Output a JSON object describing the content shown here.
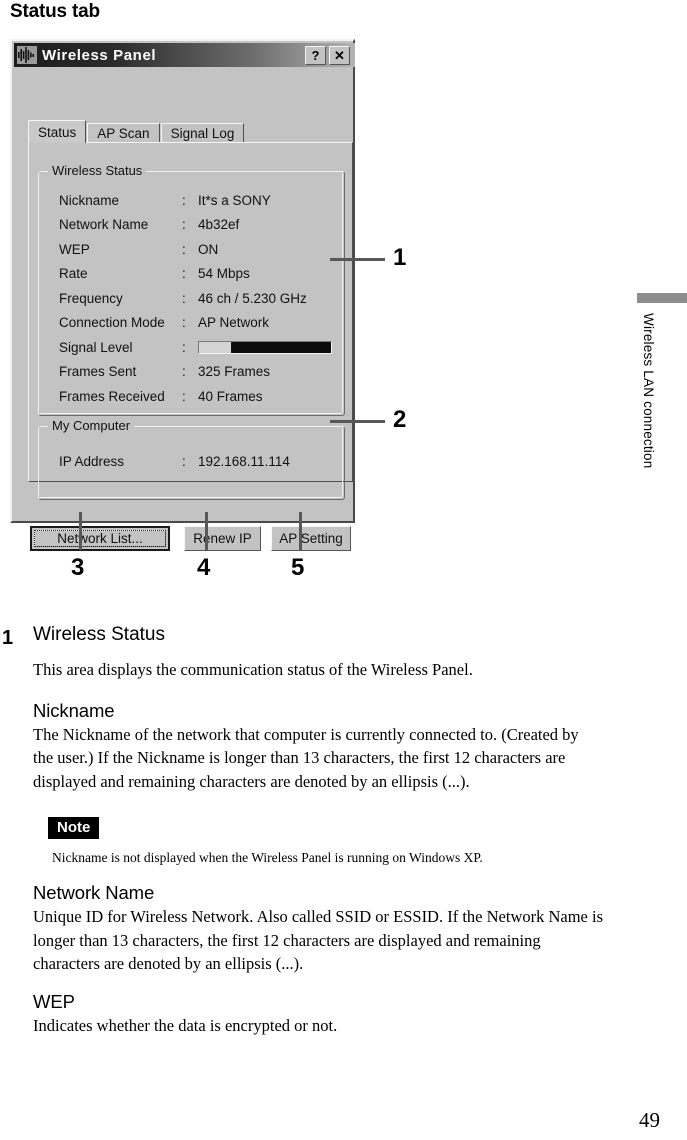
{
  "page": {
    "heading": "Status tab",
    "number": "49",
    "side_tab": "Wireless LAN connection"
  },
  "dialog": {
    "title": "Wireless Panel",
    "title_icon": "signal-wave-icon",
    "help_button": "?",
    "close_button": "✕",
    "tabs": [
      {
        "label": "Status",
        "active": true
      },
      {
        "label": "AP Scan",
        "active": false
      },
      {
        "label": "Signal Log",
        "active": false
      }
    ],
    "wireless_status": {
      "group_title": "Wireless Status",
      "rows": [
        {
          "label": "Nickname",
          "separator": ":",
          "value": "It*s a SONY"
        },
        {
          "label": "Network Name",
          "separator": ":",
          "value": "4b32ef"
        },
        {
          "label": "WEP",
          "separator": ":",
          "value": "ON"
        },
        {
          "label": "Rate",
          "separator": ":",
          "value": "54 Mbps"
        },
        {
          "label": "Frequency",
          "separator": ":",
          "value": "46 ch / 5.230 GHz"
        },
        {
          "label": "Connection Mode",
          "separator": ":",
          "value": "AP Network"
        },
        {
          "label": "Signal Level",
          "separator": ":",
          "value": "",
          "type": "progress",
          "fill_percent": 75
        },
        {
          "label": "Frames Sent",
          "separator": ":",
          "value": "325 Frames"
        },
        {
          "label": "Frames Received",
          "separator": ":",
          "value": "40 Frames"
        }
      ]
    },
    "my_computer": {
      "group_title": "My Computer",
      "rows": [
        {
          "label": "IP Address",
          "separator": ":",
          "value": "192.168.11.114"
        }
      ]
    },
    "buttons": [
      {
        "label": "Network List...",
        "default": true
      },
      {
        "label": "Renew IP",
        "default": false
      },
      {
        "label": "AP Setting",
        "default": false
      }
    ]
  },
  "callouts": {
    "one": "1",
    "two": "2",
    "three": "3",
    "four": "4",
    "five": "5"
  },
  "content": {
    "step_number": "1",
    "step_title": "Wireless Status",
    "step_intro": "This area displays the communication status of the Wireless Panel.",
    "sections": [
      {
        "heading": "Nickname",
        "text": "The Nickname of the network that computer is currently connected to. (Created by the user.) If the Nickname is longer than 13 characters, the first 12 characters are displayed and remaining characters are denoted by an ellipsis (...)."
      },
      {
        "heading": "Network Name",
        "text": "Unique ID for Wireless Network. Also called SSID or ESSID. If the Network Name is longer than 13 characters, the first 12 characters are displayed and remaining characters are denoted by an ellipsis (...)."
      },
      {
        "heading": "WEP",
        "text": "Indicates whether the data is encrypted or not."
      }
    ],
    "note": {
      "badge": "Note",
      "text": "Nickname is not displayed when the Wireless Panel is running on Windows XP."
    }
  },
  "colors": {
    "dialog_face": "#c3c3c3",
    "titlebar_dark": "#1b1b1b",
    "signal_fill": "#0b0b0b",
    "side_tab_bar": "#8d8d8d"
  }
}
